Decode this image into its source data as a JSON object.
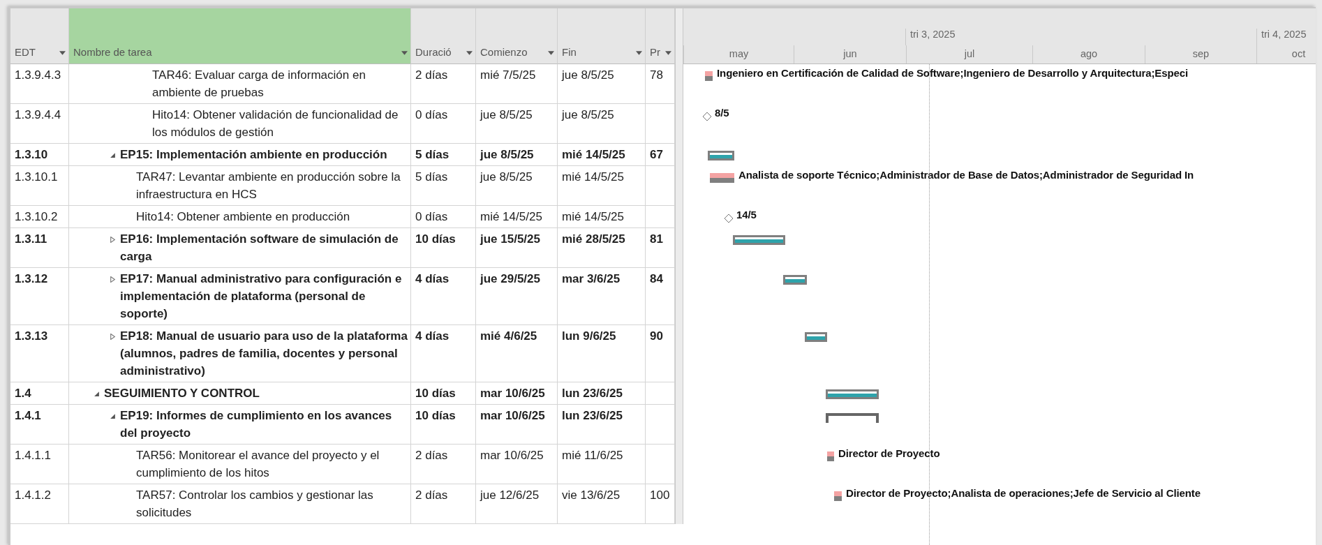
{
  "columns": [
    {
      "label": "EDT",
      "selected": false
    },
    {
      "label": "Nombre de tarea",
      "selected": true
    },
    {
      "label": "Duració",
      "selected": false
    },
    {
      "label": "Comienzo",
      "selected": false
    },
    {
      "label": "Fin",
      "selected": false
    },
    {
      "label": "Pr",
      "selected": false
    }
  ],
  "timescale": {
    "quarters": [
      "tri 3, 2025",
      "tri 4, 2025"
    ],
    "months": [
      "may",
      "jun",
      "jul",
      "ago",
      "sep",
      "oct"
    ]
  },
  "rows": [
    {
      "wbs": "1.3.9.4.3",
      "name": "TAR46: Evaluar carga de información en ambiente de pruebas",
      "duration": "2 días",
      "start": "mié 7/5/25",
      "finish": "jue 8/5/25",
      "percent": "78",
      "summary": false,
      "bar": {
        "kind": "task",
        "label": "Ingeniero en Certificación de Calidad de Software;Ingeniero de Desarrollo y Arquitectura;Especi"
      }
    },
    {
      "wbs": "1.3.9.4.4",
      "name": "Hito14: Obtener validación de funcionalidad de los módulos de gestión",
      "duration": "0 días",
      "start": "jue 8/5/25",
      "finish": "jue 8/5/25",
      "summary": false,
      "bar": {
        "kind": "milestone",
        "label": "8/5"
      }
    },
    {
      "wbs": "1.3.10",
      "name": "EP15: Implementación ambiente en producción",
      "duration": "5 días",
      "start": "jue 8/5/25",
      "finish": "mié 14/5/25",
      "percent": "67",
      "summary": true,
      "expanded": true,
      "bar": {
        "kind": "summary"
      },
      "children": [
        {
          "wbs": "1.3.10.1",
          "name": "TAR47: Levantar ambiente en producción sobre la infraestructura en HCS",
          "duration": "5 días",
          "start": "jue 8/5/25",
          "finish": "mié 14/5/25",
          "summary": false,
          "bar": {
            "kind": "task",
            "label": "Analista de soporte Técnico;Administrador de Base de Datos;Administrador de Seguridad In"
          }
        },
        {
          "wbs": "1.3.10.2",
          "name": "Hito14: Obtener ambiente en producción",
          "duration": "0 días",
          "start": "mié 14/5/25",
          "finish": "mié 14/5/25",
          "summary": false,
          "bar": {
            "kind": "milestone",
            "label": "14/5"
          }
        }
      ]
    },
    {
      "wbs": "1.3.11",
      "name": "EP16: Implementación software de simulación de carga",
      "duration": "10 días",
      "start": "jue 15/5/25",
      "finish": "mié 28/5/25",
      "percent": "81",
      "summary": true,
      "expanded": false,
      "bar": {
        "kind": "summary"
      }
    },
    {
      "wbs": "1.3.12",
      "name": "EP17: Manual administrativo para configuración e implementación de plataforma (personal de soporte)",
      "duration": "4 días",
      "start": "jue 29/5/25",
      "finish": "mar 3/6/25",
      "percent": "84",
      "summary": true,
      "expanded": false,
      "bar": {
        "kind": "summary"
      }
    },
    {
      "wbs": "1.3.13",
      "name": "EP18: Manual de usuario para uso de la plataforma (alumnos, padres de familia, docentes y personal administrativo)",
      "duration": "4 días",
      "start": "mié 4/6/25",
      "finish": "lun 9/6/25",
      "percent": "90",
      "summary": true,
      "expanded": false,
      "bar": {
        "kind": "summary"
      }
    },
    {
      "wbs": "1.4",
      "name": "SEGUIMIENTO Y CONTROL",
      "duration": "10 días",
      "start": "mar 10/6/25",
      "finish": "lun 23/6/25",
      "summary": true,
      "expanded": true,
      "bar": {
        "kind": "summary"
      },
      "children": [
        {
          "wbs": "1.4.1",
          "name": "EP19: Informes de cumplimiento en los avances del proyecto",
          "duration": "10 días",
          "start": "mar 10/6/25",
          "finish": "lun 23/6/25",
          "summary": true,
          "expanded": true,
          "bar": {
            "kind": "bracket"
          },
          "children": [
            {
              "wbs": "1.4.1.1",
              "name": "TAR56:  Monitorear el avance del proyecto y el cumplimiento de los hitos",
              "duration": "2 días",
              "start": "mar 10/6/25",
              "finish": "mié 11/6/25",
              "summary": false,
              "bar": {
                "kind": "task",
                "label": "Director de Proyecto"
              }
            },
            {
              "wbs": "1.4.1.2",
              "name": "TAR57:  Controlar los cambios y gestionar las solicitudes",
              "duration": "2 días",
              "start": "jue 12/6/25",
              "finish": "vie 13/6/25",
              "percent": "100",
              "summary": false,
              "bar": {
                "kind": "task",
                "label": "Director de Proyecto;Analista de operaciones;Jefe de Servicio al Cliente"
              }
            }
          ]
        }
      ]
    }
  ]
}
